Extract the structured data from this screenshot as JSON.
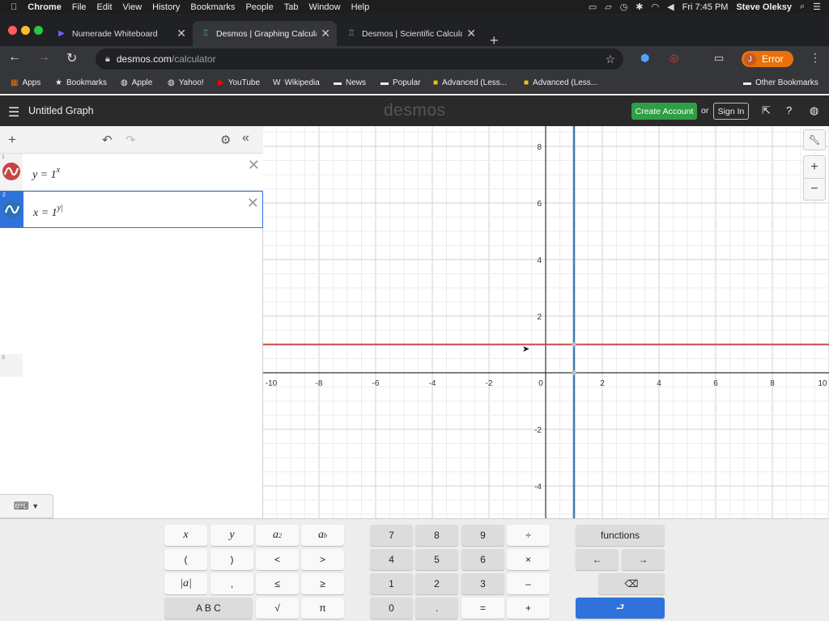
{
  "menubar": {
    "app": "Chrome",
    "items": [
      "File",
      "Edit",
      "View",
      "History",
      "Bookmarks",
      "People",
      "Tab",
      "Window",
      "Help"
    ],
    "clock": "Fri 7:45 PM",
    "user": "Steve Oleksy"
  },
  "tabs": [
    {
      "title": "Numerade Whiteboard",
      "active": false
    },
    {
      "title": "Desmos | Graphing Calculator",
      "active": true
    },
    {
      "title": "Desmos | Scientific Calculator",
      "active": false
    }
  ],
  "omnibox": {
    "host": "desmos.com",
    "path": "/calculator"
  },
  "profile": {
    "initial": "J",
    "label": "Error"
  },
  "bookmarks": [
    "Apps",
    "Bookmarks",
    "Apple",
    "Yahoo!",
    "YouTube",
    "Wikipedia",
    "News",
    "Popular",
    "Advanced (Less...",
    "Advanced (Less..."
  ],
  "other_bookmarks": "Other Bookmarks",
  "desmos": {
    "graph_title": "Untitled Graph",
    "logo": "desmos",
    "create_account": "Create Account",
    "or": "or",
    "sign_in": "Sign In"
  },
  "expressions": [
    {
      "index": "1",
      "lhs": "y = 1",
      "exp": "x",
      "color": "#c74440",
      "selected": false
    },
    {
      "index": "2",
      "lhs": "x = 1",
      "exp": "y|",
      "color": "#2d70b3",
      "selected": true
    }
  ],
  "empty_row_index": "3",
  "graph": {
    "x_ticks": [
      "-10",
      "-8",
      "-6",
      "-4",
      "-2",
      "0",
      "2",
      "4",
      "6",
      "8",
      "10"
    ],
    "y_ticks": [
      "8",
      "6",
      "4",
      "2",
      "-2",
      "-4"
    ],
    "xlim": [
      -10,
      10
    ],
    "ylim": [
      -5,
      8.7
    ],
    "curves": [
      {
        "name": "y = 1^x",
        "kind": "horizontal",
        "value": 1,
        "color": "#c74440"
      },
      {
        "name": "x = 1^y",
        "kind": "vertical",
        "value": 1,
        "color": "#2d70b3"
      }
    ]
  },
  "keypad": {
    "left": [
      [
        "x",
        "y",
        "a2",
        "ab"
      ],
      [
        "(",
        ")",
        "<",
        ">"
      ],
      [
        "|a|",
        ",",
        "≤",
        "≥"
      ],
      [
        "A B C",
        "√",
        "π"
      ]
    ],
    "mid": [
      [
        "7",
        "8",
        "9",
        "÷"
      ],
      [
        "4",
        "5",
        "6",
        "×"
      ],
      [
        "1",
        "2",
        "3",
        "–"
      ],
      [
        "0",
        ".",
        "=",
        "+"
      ]
    ],
    "functions": "functions",
    "left_arrow": "←",
    "right_arrow": "→",
    "backspace": "⌫",
    "enter": "⮐"
  }
}
